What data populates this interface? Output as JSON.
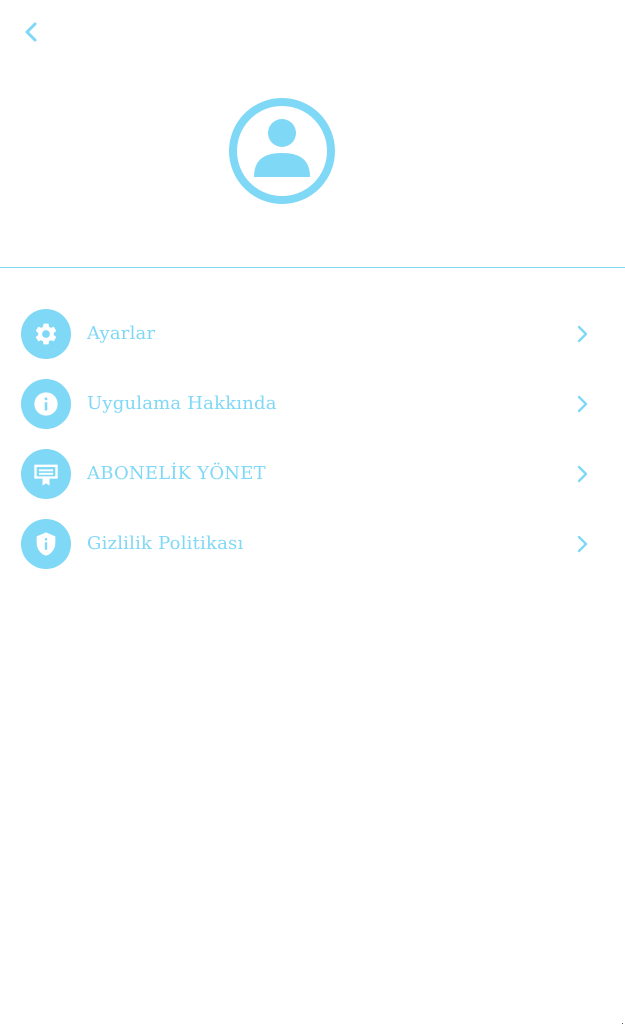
{
  "colors": {
    "accent": "#7fd8f6",
    "background": "#ffffff"
  },
  "header": {
    "back_icon": "chevron-left-icon"
  },
  "profile": {
    "avatar_icon": "account-circle-icon"
  },
  "menu": {
    "items": [
      {
        "label": "Ayarlar",
        "icon": "gear-icon"
      },
      {
        "label": "Uygulama Hakkında",
        "icon": "info-icon"
      },
      {
        "label": "ABONELİK YÖNET",
        "icon": "subscription-card-icon"
      },
      {
        "label": "Gizlilik Politikası",
        "icon": "shield-info-icon"
      }
    ],
    "chevron_icon": "chevron-right-icon"
  }
}
